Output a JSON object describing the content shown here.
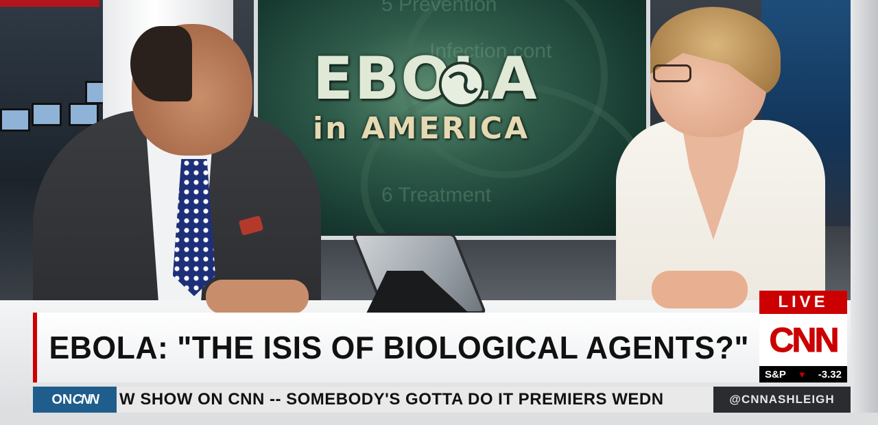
{
  "wall_graphic": {
    "line1": "EBOLA",
    "line2": "in AMERICA",
    "ghost_text": [
      "5 Prevention",
      "Infection cont",
      "6 Treatment"
    ]
  },
  "lower_third": {
    "headline": "EBOLA: \"THE ISIS OF BIOLOGICAL AGENTS?\""
  },
  "bug": {
    "live_label": "LIVE",
    "network_logo": "CNN",
    "ticker_symbol": "S&P",
    "ticker_direction_icon": "down-triangle-icon",
    "ticker_value": "-3.32"
  },
  "crawl": {
    "on_prefix": "ON",
    "on_network": "CNN",
    "text": "W SHOW ON CNN -- SOMEBODY'S GOTTA DO IT PREMIERS WEDN",
    "social_handle": "@CNNASHLEIGH"
  },
  "colors": {
    "brand_red": "#cc0000",
    "crawl_blue": "#1f5d8c",
    "wall_green": "#2f5b4a"
  }
}
